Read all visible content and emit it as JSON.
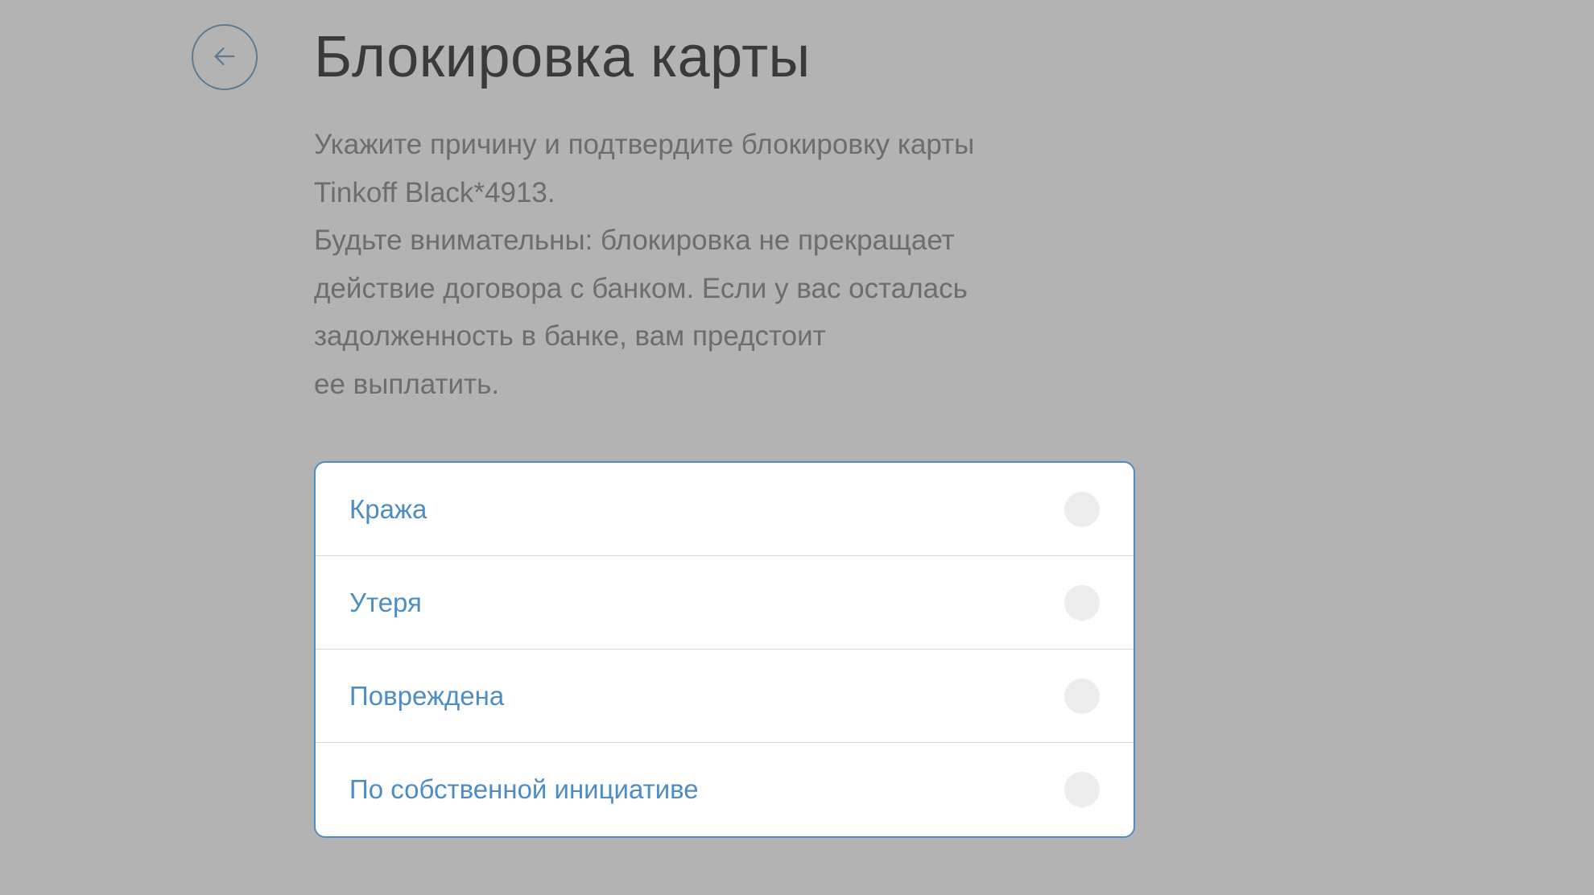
{
  "header": {
    "title": "Блокировка карты"
  },
  "description": {
    "line1": "Укажите причину и подтвердите блокировку карты",
    "line2": "Tinkoff Black*4913.",
    "line3": "Будьте внимательны: блокировка не прекращает",
    "line4": "действие договора с банком. Если у вас осталась",
    "line5": "задолженность в банке, вам предстоит",
    "line6": "ее выплатить."
  },
  "options": {
    "item0": {
      "label": "Кража"
    },
    "item1": {
      "label": "Утеря"
    },
    "item2": {
      "label": "Повреждена"
    },
    "item3": {
      "label": "По собственной инициативе"
    }
  },
  "colors": {
    "accent": "#4d8dc4",
    "background": "#b3b3b3",
    "text_primary": "#3a3a3a",
    "text_secondary": "#6d6d6d"
  }
}
